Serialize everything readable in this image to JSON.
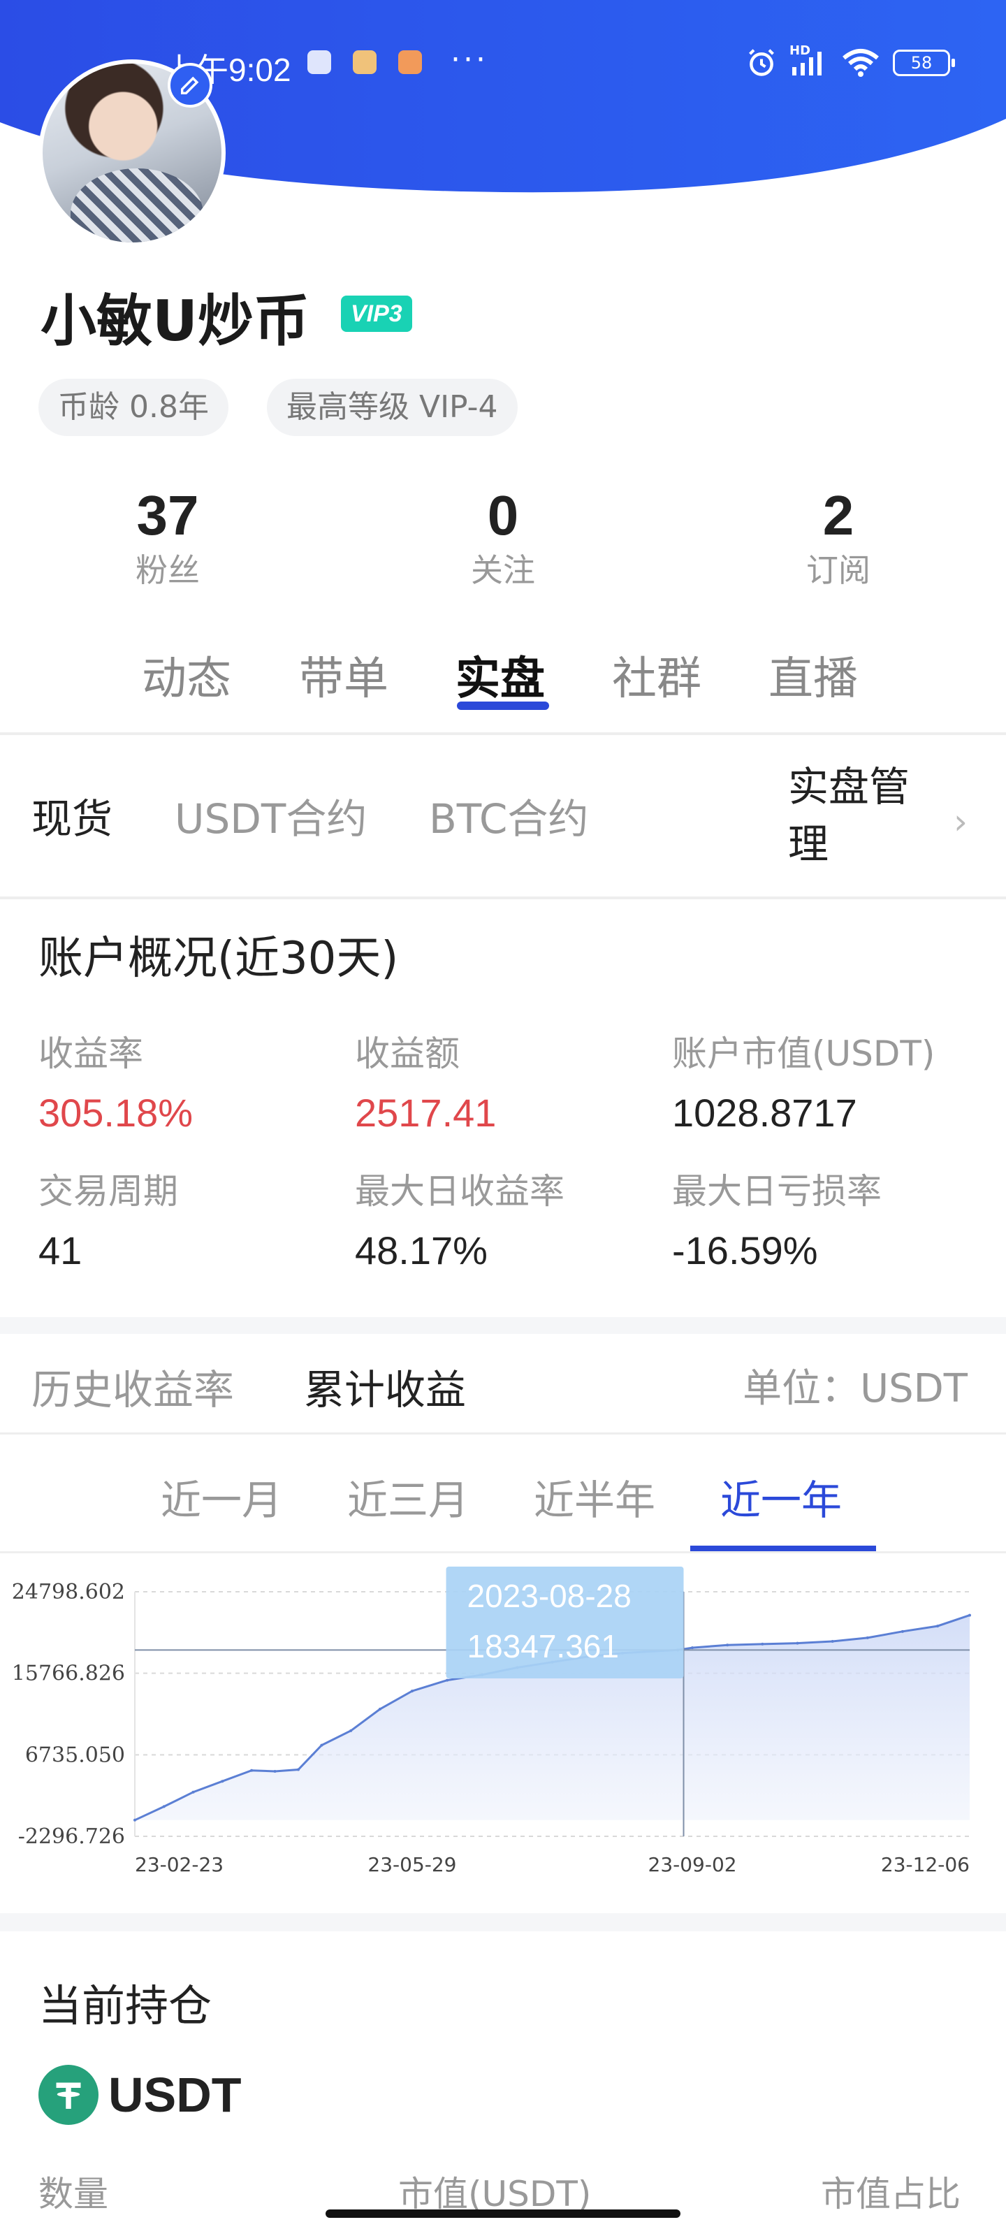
{
  "status_bar": {
    "time": "上午9:02",
    "battery": "58",
    "signal_label": "HD"
  },
  "profile": {
    "name": "小敏U炒币",
    "vip": "VIP3",
    "chips": [
      "币龄 0.8年",
      "最高等级 VIP-4"
    ]
  },
  "stats": [
    {
      "value": "37",
      "label": "粉丝"
    },
    {
      "value": "0",
      "label": "关注"
    },
    {
      "value": "2",
      "label": "订阅"
    }
  ],
  "tabs": [
    "动态",
    "带单",
    "实盘",
    "社群",
    "直播"
  ],
  "active_tab": "实盘",
  "sub_tabs": [
    "现货",
    "USDT合约",
    "BTC合约"
  ],
  "manage_label_line1": "实盘管",
  "manage_label_line2": "理",
  "overview": {
    "title": "账户概况(近30天)",
    "metrics": [
      {
        "label": "收益率",
        "value": "305.18%"
      },
      {
        "label": "收益额",
        "value": "2517.41"
      },
      {
        "label": "账户市值(USDT)",
        "value": "1028.8717"
      },
      {
        "label": "交易周期",
        "value": "41"
      },
      {
        "label": "最大日收益率",
        "value": "48.17%"
      },
      {
        "label": "最大日亏损率",
        "value": "-16.59%"
      }
    ]
  },
  "chart_tabs": [
    "历史收益率",
    "累计收益"
  ],
  "unit_label": "单位：USDT",
  "periods": [
    "近一月",
    "近三月",
    "近半年",
    "近一年"
  ],
  "tooltip": {
    "date": "2023-08-28",
    "value": "18347.361"
  },
  "chart_data": {
    "type": "area",
    "y_ticks": [
      "24798.602",
      "15766.826",
      "6735.050",
      "-2296.726"
    ],
    "x_ticks": [
      "23-02-23",
      "23-05-29",
      "23-09-02",
      "23-12-06"
    ],
    "ylim": [
      -2296.726,
      24798.602
    ],
    "x_range": [
      "2023-02-23",
      "2023-12-06"
    ],
    "grid": true,
    "x": [
      "2023-02-23",
      "2023-03-05",
      "2023-03-15",
      "2023-03-25",
      "2023-04-04",
      "2023-04-12",
      "2023-04-20",
      "2023-04-28",
      "2023-05-08",
      "2023-05-18",
      "2023-05-29",
      "2023-06-10",
      "2023-06-22",
      "2023-07-04",
      "2023-07-16",
      "2023-07-28",
      "2023-08-09",
      "2023-08-28",
      "2023-09-02",
      "2023-09-14",
      "2023-09-26",
      "2023-10-08",
      "2023-10-20",
      "2023-11-01",
      "2023-11-13",
      "2023-11-25",
      "2023-12-06"
    ],
    "values": [
      -500,
      1000,
      2600,
      3800,
      5000,
      4900,
      5100,
      7800,
      9400,
      11800,
      13800,
      15000,
      15600,
      16400,
      17000,
      17600,
      18000,
      18347,
      18600,
      18900,
      19000,
      19100,
      19300,
      19700,
      20400,
      21000,
      22200
    ]
  },
  "holdings": {
    "title": "当前持仓",
    "coin": "USDT",
    "columns": [
      "数量",
      "市值(USDT)",
      "市值占比"
    ]
  }
}
